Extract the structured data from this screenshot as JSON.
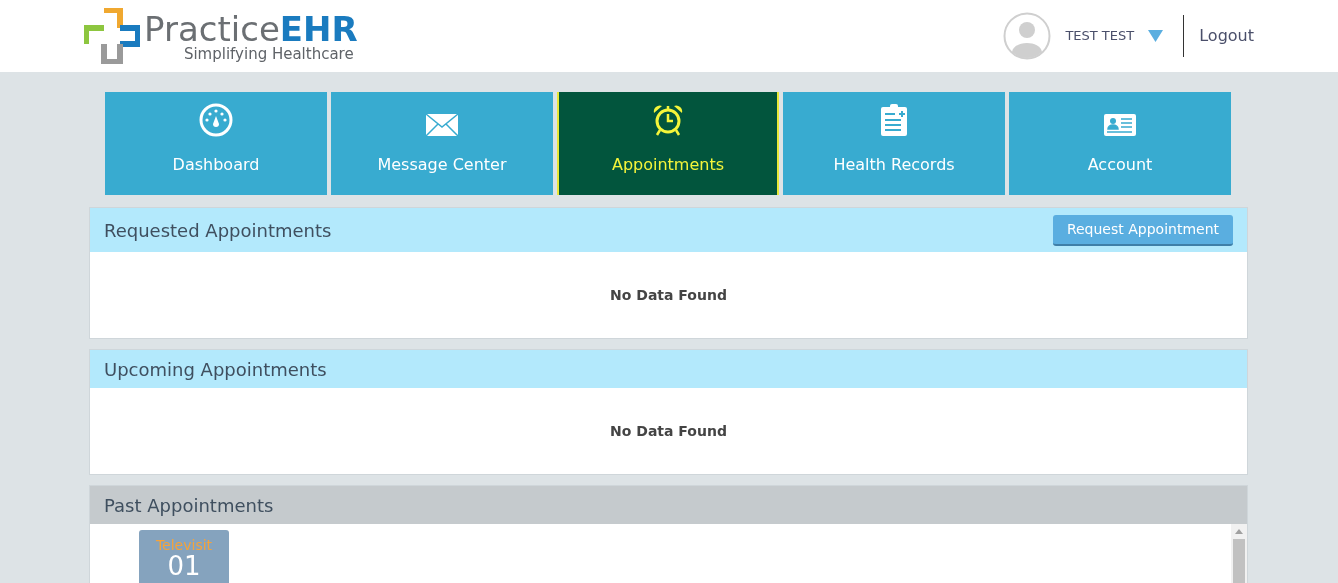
{
  "logo": {
    "name": "Practice",
    "name_bold": "EHR",
    "tagline": "Simplifying Healthcare"
  },
  "user": {
    "name": "TEST TEST",
    "logout": "Logout"
  },
  "nav": [
    {
      "label": "Dashboard",
      "kind": "dashboard",
      "selected": false
    },
    {
      "label": "Message Center",
      "kind": "mail",
      "selected": false
    },
    {
      "label": "Appointments",
      "kind": "alarm",
      "selected": true
    },
    {
      "label": "Health Records",
      "kind": "clipboard",
      "selected": false
    },
    {
      "label": "Account",
      "kind": "idcard",
      "selected": false
    }
  ],
  "panels": [
    {
      "title": "Requested Appointments",
      "kind": "requested",
      "button": "Request Appointment",
      "empty": "No Data Found"
    },
    {
      "title": "Upcoming Appointments",
      "kind": "upcoming",
      "empty": "No Data Found"
    },
    {
      "title": "Past Appointments",
      "kind": "past",
      "items": [
        {
          "type": "Televisit",
          "day": "01"
        }
      ]
    }
  ]
}
